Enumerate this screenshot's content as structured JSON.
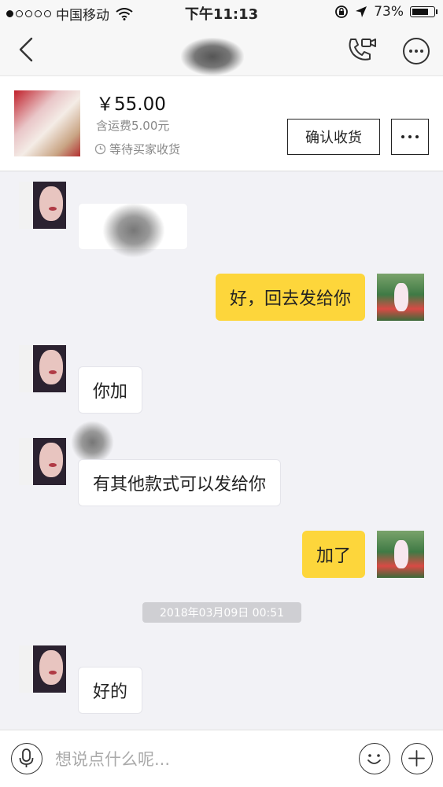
{
  "status_bar": {
    "carrier": "中国移动",
    "time": "下午11:13",
    "battery": "73%",
    "battery_level": 0.73
  },
  "nav": {
    "back_icon": "chevron-left-icon",
    "call_icon": "phone-video-icon",
    "more_icon": "more-circle-icon"
  },
  "order": {
    "price": "￥55.00",
    "shipping": "含运费5.00元",
    "status": "等待买家收货",
    "confirm_button": "确认收货",
    "more_icon": "ellipsis-icon"
  },
  "messages": [
    {
      "sender": "buyer",
      "text": ""
    },
    {
      "sender": "seller",
      "text": "好，回去发给你"
    },
    {
      "sender": "buyer",
      "text": "你加"
    },
    {
      "sender": "buyer",
      "text": "有其他款式可以发给你"
    },
    {
      "sender": "seller",
      "text": "加了"
    },
    {
      "sender": "buyer",
      "text": "好的"
    }
  ],
  "timestamp": "2018年03月09日  00:51",
  "input": {
    "placeholder": "想说点什么呢..."
  },
  "colors": {
    "accent_bubble": "#fdd63b",
    "background": "#f2f2f6"
  }
}
